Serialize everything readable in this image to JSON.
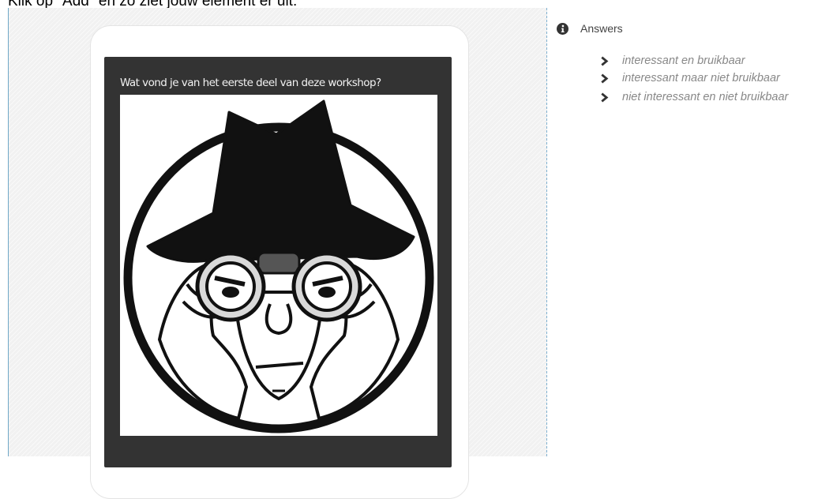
{
  "instruction": "Klik op \"Add\" en zo ziet jouw element er uit:",
  "preview": {
    "question": "Wat vond je van het eerste deel van deze workshop?",
    "image_icon": "spy-with-binoculars-illustration"
  },
  "answers_panel": {
    "icon": "info-icon",
    "title": "Answers",
    "items": [
      {
        "label": "interessant en bruikbaar",
        "icon": "chevron-right-icon"
      },
      {
        "label": "interessant maar niet bruikbaar",
        "icon": "chevron-right-icon"
      },
      {
        "label": "niet interessant en niet bruikbaar",
        "icon": "chevron-right-icon"
      }
    ]
  },
  "colors": {
    "screen_bg": "#333333",
    "question_text": "#f2f2f2",
    "answer_text": "#888888",
    "divider": "#7fb0d0"
  }
}
